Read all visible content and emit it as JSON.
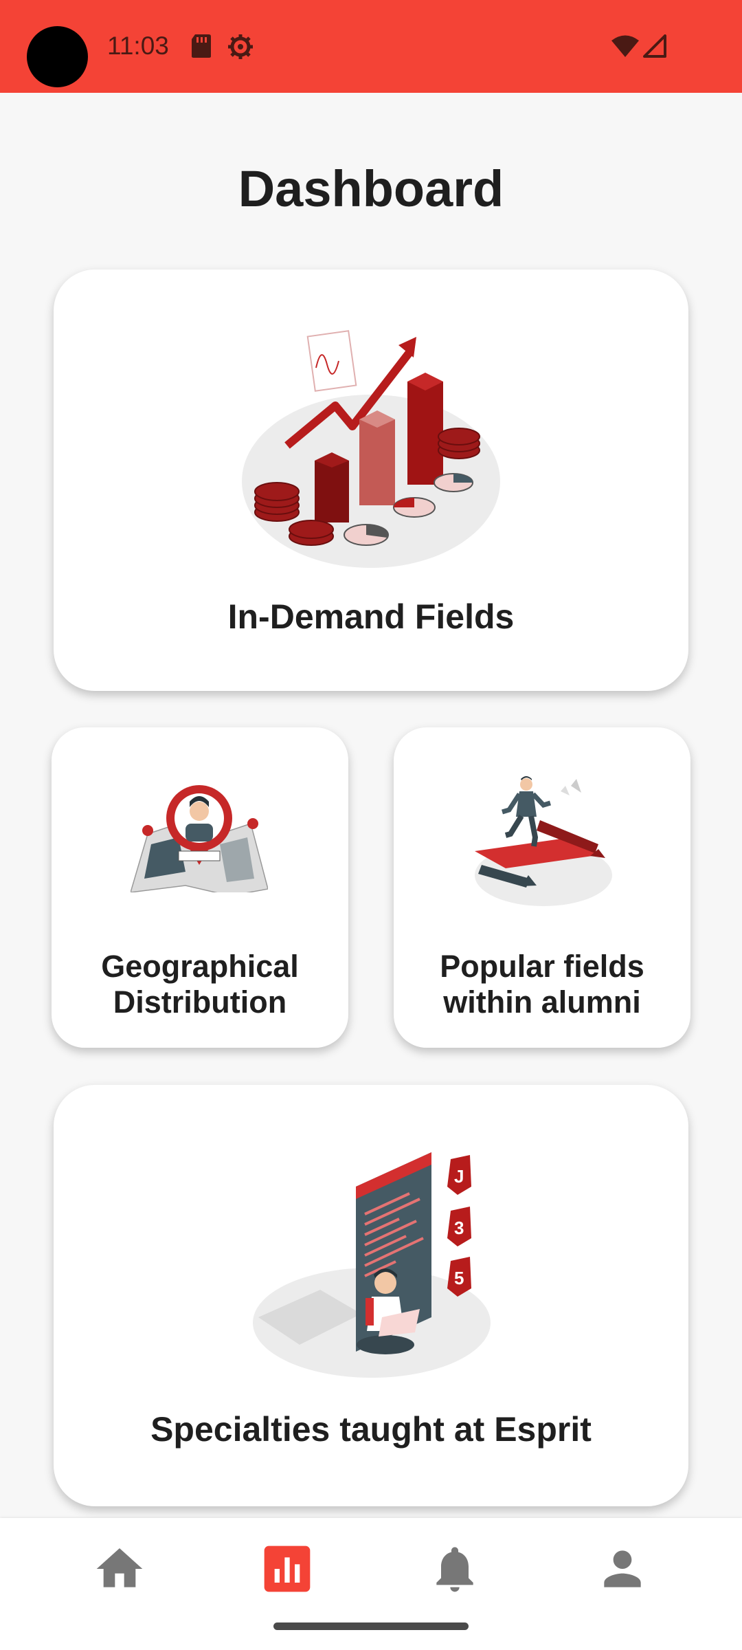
{
  "status_bar": {
    "time": "11:03",
    "icons": [
      "sd-card-icon",
      "settings-icon",
      "wifi-icon",
      "signal-icon"
    ]
  },
  "page": {
    "title": "Dashboard"
  },
  "cards": {
    "in_demand": {
      "label": "In-Demand Fields",
      "icon": "growth-chart-illustration"
    },
    "geo": {
      "label_line1": "Geographical",
      "label_line2": "Distribution",
      "icon": "map-pin-illustration"
    },
    "popular": {
      "label_line1": "Popular fields",
      "label_line2": "within alumni",
      "icon": "runner-illustration"
    },
    "specialties": {
      "label": "Specialties taught at Esprit",
      "icon": "developer-illustration"
    }
  },
  "bottom_nav": {
    "items": [
      {
        "name": "home",
        "icon": "home-icon",
        "active": false
      },
      {
        "name": "dashboard",
        "icon": "bar-chart-icon",
        "active": true
      },
      {
        "name": "notifications",
        "icon": "bell-icon",
        "active": false
      },
      {
        "name": "profile",
        "icon": "person-icon",
        "active": false
      }
    ]
  },
  "colors": {
    "accent": "#f44336",
    "dark_red": "#b71c1c",
    "text": "#1f1f1f",
    "nav_inactive": "#777777"
  }
}
